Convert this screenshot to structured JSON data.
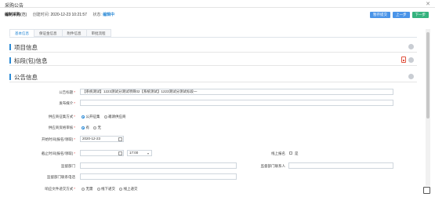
{
  "window": {
    "title": "采购公告",
    "close": "✕"
  },
  "info": {
    "doc_type": "编制采购",
    "doc_type_suffix": "(范)",
    "created_label": "创建时间:",
    "created_value": "2020-12-23 10:21:57",
    "status_label": "状态:",
    "status_value": "编辑中"
  },
  "buttons": {
    "save": "暂存提交",
    "prev": "上一步",
    "next": "下一步"
  },
  "tabs": [
    "基本信息",
    "保证金信息",
    "附件信息",
    "审批流程"
  ],
  "sections": {
    "project": "项目信息",
    "lots": "标段(包)信息",
    "notice": "公告信息"
  },
  "form": {
    "title_label": "公告标题",
    "title_value": "【系统测试】1223测试分测试项目02【系统测试】1223测试分测试标段一",
    "media_label": "发布媒介",
    "method_label": "供应商征集方式",
    "method_options": [
      "公开征集",
      "邀请供应商"
    ],
    "qual_label": "供应商资格审核",
    "qual_options": [
      "有",
      "无"
    ],
    "open_label": "开始时间(报名/领取)",
    "open_value": "2020-12-23",
    "close_label": "截止时间(报名/领取)",
    "close_time": "17:00",
    "online_label": "线上报名",
    "online_value": "是",
    "dept_label": "监督部门",
    "contact_label": "监督部门联系人",
    "phone_label": "监督部门联系电话",
    "file_label": "响应文件递交方式",
    "file_options": [
      "无需",
      "线下递交",
      "线上递交"
    ]
  }
}
